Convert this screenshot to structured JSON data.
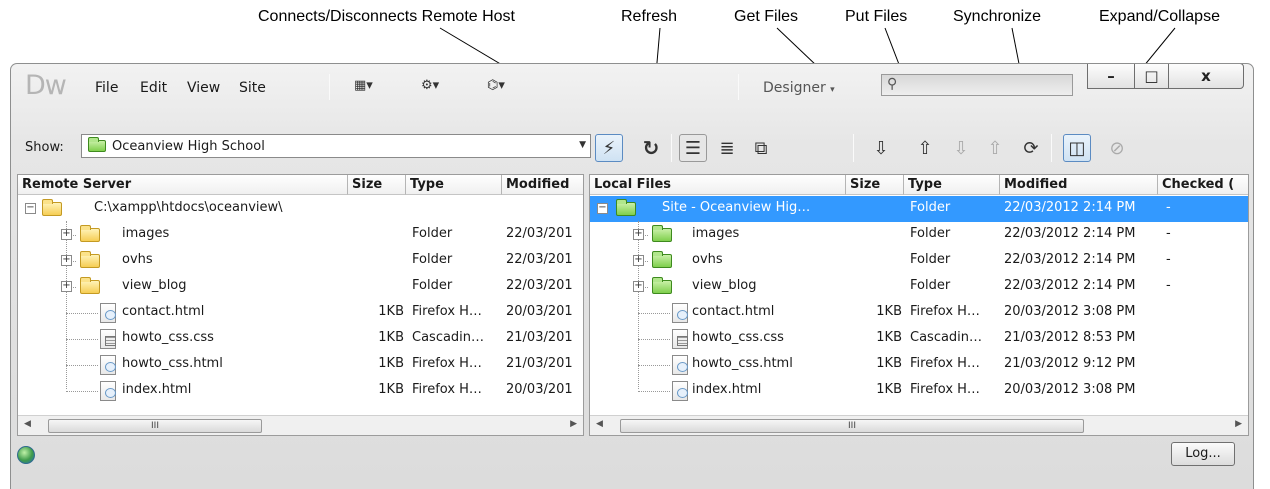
{
  "callouts": {
    "connect": "Connects/Disconnects Remote Host",
    "refresh": "Refresh",
    "get": "Get Files",
    "put": "Put Files",
    "sync": "Synchronize",
    "expand": "Expand/Collapse"
  },
  "app": {
    "logo": "Dw",
    "menu": [
      "File",
      "Edit",
      "View",
      "Site"
    ],
    "workspace": "Designer",
    "search_placeholder": "",
    "window_controls": {
      "minimize": "–",
      "maximize": "□",
      "close": "x"
    }
  },
  "toolbar": {
    "show_label": "Show:",
    "site_selected": "Oceanview High School"
  },
  "remote": {
    "headers": {
      "name": "Remote Server",
      "size": "Size",
      "type": "Type",
      "modified": "Modified"
    },
    "root": "C:\\xampp\\htdocs\\oceanview\\",
    "rows": [
      {
        "name": "images",
        "size": "",
        "type": "Folder",
        "modified": "22/03/201",
        "kind": "folder"
      },
      {
        "name": "ovhs",
        "size": "",
        "type": "Folder",
        "modified": "22/03/201",
        "kind": "folder"
      },
      {
        "name": "view_blog",
        "size": "",
        "type": "Folder",
        "modified": "22/03/201",
        "kind": "folder"
      },
      {
        "name": "contact.html",
        "size": "1KB",
        "type": "Firefox H…",
        "modified": "20/03/201",
        "kind": "html"
      },
      {
        "name": "howto_css.css",
        "size": "1KB",
        "type": "Cascadin…",
        "modified": "21/03/201",
        "kind": "css"
      },
      {
        "name": "howto_css.html",
        "size": "1KB",
        "type": "Firefox H…",
        "modified": "21/03/201",
        "kind": "html"
      },
      {
        "name": "index.html",
        "size": "1KB",
        "type": "Firefox H…",
        "modified": "20/03/201",
        "kind": "html"
      }
    ]
  },
  "local": {
    "headers": {
      "name": "Local Files",
      "size": "Size",
      "type": "Type",
      "modified": "Modified",
      "checked": "Checked ("
    },
    "root": {
      "name": "Site - Oceanview Hig…",
      "type": "Folder",
      "modified": "22/03/2012 2:14 PM",
      "checked": "-"
    },
    "rows": [
      {
        "name": "images",
        "size": "",
        "type": "Folder",
        "modified": "22/03/2012 2:14 PM",
        "checked": "-",
        "kind": "folder"
      },
      {
        "name": "ovhs",
        "size": "",
        "type": "Folder",
        "modified": "22/03/2012 2:14 PM",
        "checked": "-",
        "kind": "folder"
      },
      {
        "name": "view_blog",
        "size": "",
        "type": "Folder",
        "modified": "22/03/2012 2:14 PM",
        "checked": "-",
        "kind": "folder"
      },
      {
        "name": "contact.html",
        "size": "1KB",
        "type": "Firefox H…",
        "modified": "20/03/2012 3:08 PM",
        "checked": "",
        "kind": "html"
      },
      {
        "name": "howto_css.css",
        "size": "1KB",
        "type": "Cascadin…",
        "modified": "21/03/2012 8:53 PM",
        "checked": "",
        "kind": "css"
      },
      {
        "name": "howto_css.html",
        "size": "1KB",
        "type": "Firefox H…",
        "modified": "21/03/2012 9:12 PM",
        "checked": "",
        "kind": "html"
      },
      {
        "name": "index.html",
        "size": "1KB",
        "type": "Firefox H…",
        "modified": "20/03/2012 3:08 PM",
        "checked": "",
        "kind": "html"
      }
    ]
  },
  "scroll_thumb": "III",
  "status": {
    "log_button": "Log..."
  },
  "colors": {
    "selection": "#3399ff",
    "accent_border": "#5b8bc2"
  }
}
